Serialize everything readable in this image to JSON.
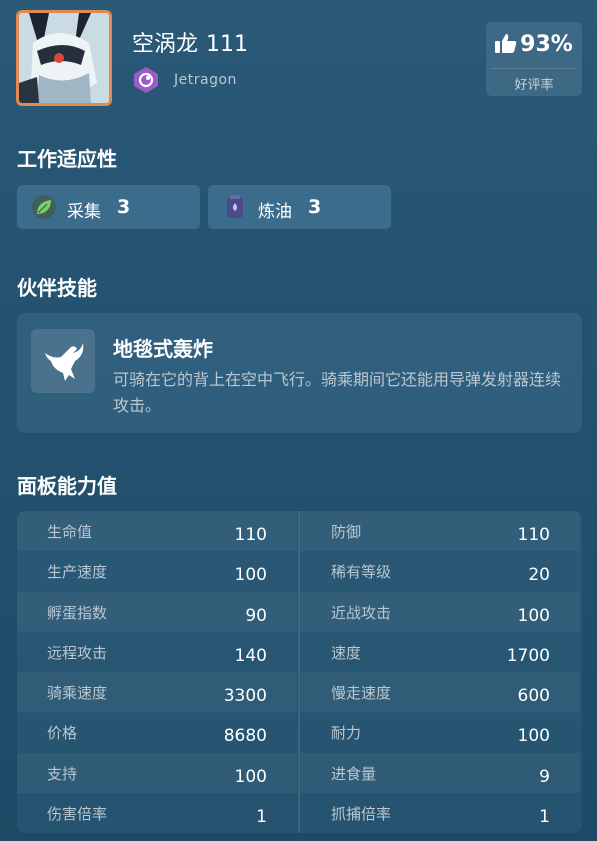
{
  "pal": {
    "name": "空涡龙",
    "number": "111",
    "species": "Jetragon",
    "rating_value": "93%",
    "rating_label": "好评率",
    "avatar_icon": "jetragon-portrait",
    "element_icon": "dragon-element-icon",
    "accent_color": "#e08a4e"
  },
  "sections": {
    "work": "工作适应性",
    "skill": "伙伴技能",
    "stats": "面板能力值"
  },
  "work": [
    {
      "name": "采集",
      "level": "3",
      "icon": "leaf-icon"
    },
    {
      "name": "炼油",
      "level": "3",
      "icon": "oil-can-icon"
    }
  ],
  "skill": {
    "name": "地毯式轰炸",
    "description": "可骑在它的背上在空中飞行。骑乘期间它还能用导弹发射器连续攻击。",
    "icon": "eagle-icon"
  },
  "stats_left": [
    {
      "label": "生命值",
      "value": "110"
    },
    {
      "label": "生产速度",
      "value": "100"
    },
    {
      "label": "孵蛋指数",
      "value": "90"
    },
    {
      "label": "远程攻击",
      "value": "140"
    },
    {
      "label": "骑乘速度",
      "value": "3300"
    },
    {
      "label": "价格",
      "value": "8680"
    },
    {
      "label": "支持",
      "value": "100"
    },
    {
      "label": "伤害倍率",
      "value": "1"
    }
  ],
  "stats_right": [
    {
      "label": "防御",
      "value": "110"
    },
    {
      "label": "稀有等级",
      "value": "20"
    },
    {
      "label": "近战攻击",
      "value": "100"
    },
    {
      "label": "速度",
      "value": "1700"
    },
    {
      "label": "慢走速度",
      "value": "600"
    },
    {
      "label": "耐力",
      "value": "100"
    },
    {
      "label": "进食量",
      "value": "9"
    },
    {
      "label": "抓捕倍率",
      "value": "1"
    }
  ]
}
